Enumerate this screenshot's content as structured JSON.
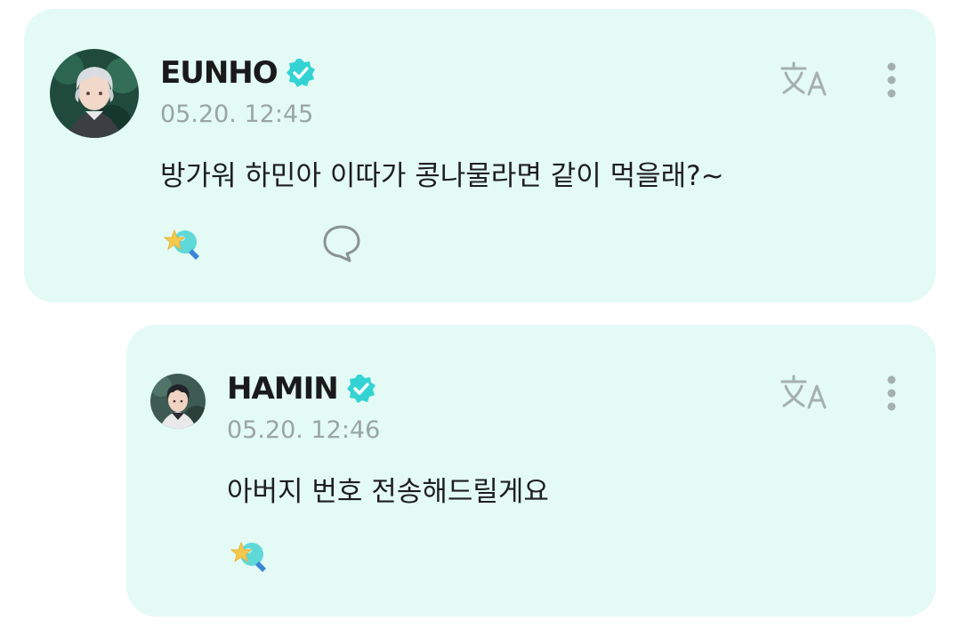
{
  "post": {
    "author": "EUNHO",
    "timestamp": "05.20. 12:45",
    "message": "방가워 하민아 이따가 콩나물라면 같이 먹을래?~"
  },
  "reply": {
    "author": "HAMIN",
    "timestamp": "05.20. 12:46",
    "message": "아버지 번호 전송해드릴게요"
  },
  "icons": {
    "verified": "verified-badge-icon",
    "translate": "translate-icon",
    "more": "more-vertical-icon",
    "reaction": "star-reaction-icon",
    "comment": "comment-bubble-icon"
  },
  "colors": {
    "card_background": "#e3faf5",
    "verified_badge": "#34d3d3",
    "icon_gray": "#9aa5a1",
    "text": "#1e1e1e"
  }
}
